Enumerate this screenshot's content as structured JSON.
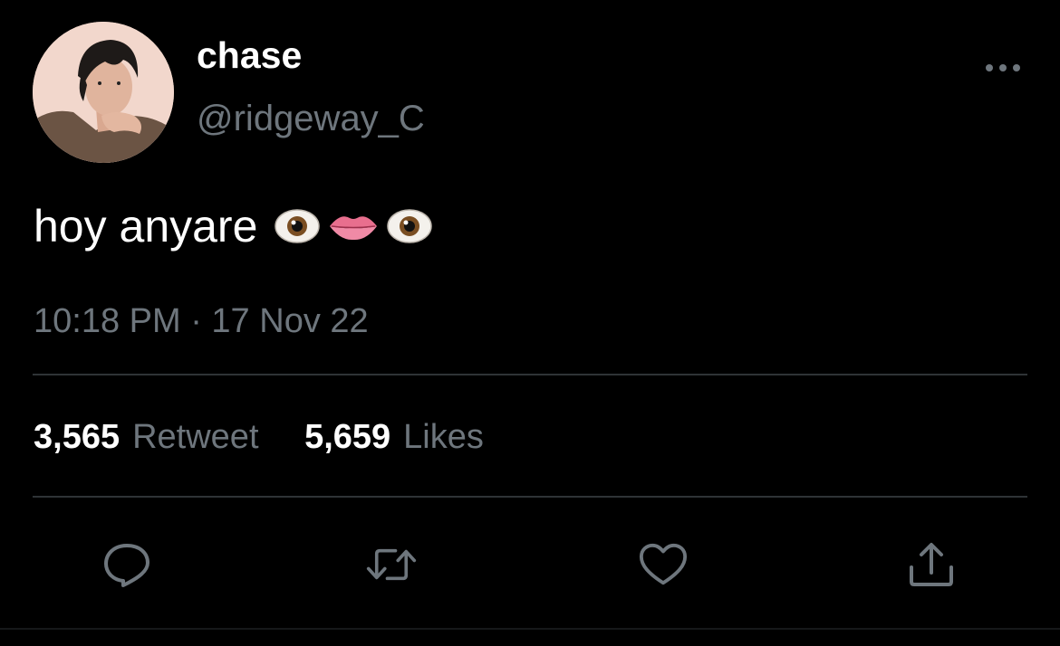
{
  "user": {
    "display_name": "chase",
    "handle": "@ridgeway_C",
    "avatar_icon": "profile-photo"
  },
  "tweet": {
    "text": "hoy anyare",
    "emojis": [
      "eye-emoji",
      "lips-emoji",
      "eye-emoji"
    ],
    "timestamp": "10:18 PM · 17 Nov 22"
  },
  "stats": {
    "retweets_count": "3,565",
    "retweets_label": "Retweet",
    "likes_count": "5,659",
    "likes_label": "Likes"
  },
  "actions": [
    "reply-icon",
    "retweet-icon",
    "like-icon",
    "share-icon"
  ],
  "colors": {
    "background": "#000000",
    "primary_text": "#ffffff",
    "secondary_text": "#6e767d",
    "divider": "#2f3336"
  }
}
